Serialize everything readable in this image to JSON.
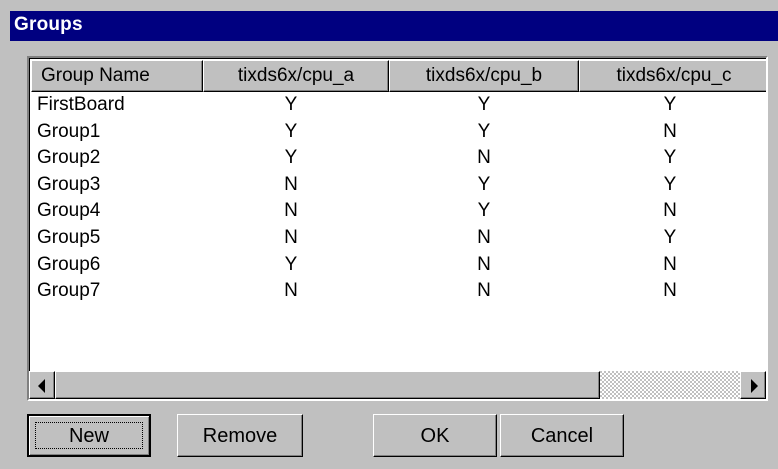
{
  "window": {
    "title": "Groups"
  },
  "list": {
    "columns": [
      {
        "label": "Group Name"
      },
      {
        "label": "tixds6x/cpu_a"
      },
      {
        "label": "tixds6x/cpu_b"
      },
      {
        "label": "tixds6x/cpu_c"
      }
    ],
    "rows": [
      [
        "FirstBoard",
        "Y",
        "Y",
        "Y"
      ],
      [
        "Group1",
        "Y",
        "Y",
        "N"
      ],
      [
        "Group2",
        "Y",
        "N",
        "Y"
      ],
      [
        "Group3",
        "N",
        "Y",
        "Y"
      ],
      [
        "Group4",
        "N",
        "Y",
        "N"
      ],
      [
        "Group5",
        "N",
        "N",
        "Y"
      ],
      [
        "Group6",
        "Y",
        "N",
        "N"
      ],
      [
        "Group7",
        "N",
        "N",
        "N"
      ]
    ]
  },
  "buttons": {
    "new": "New",
    "remove": "Remove",
    "ok": "OK",
    "cancel": "Cancel"
  },
  "icons": {
    "scroll_left": "left-arrow-icon",
    "scroll_right": "right-arrow-icon"
  },
  "colors": {
    "titlebar": "#000080",
    "face": "#c0c0c0"
  }
}
